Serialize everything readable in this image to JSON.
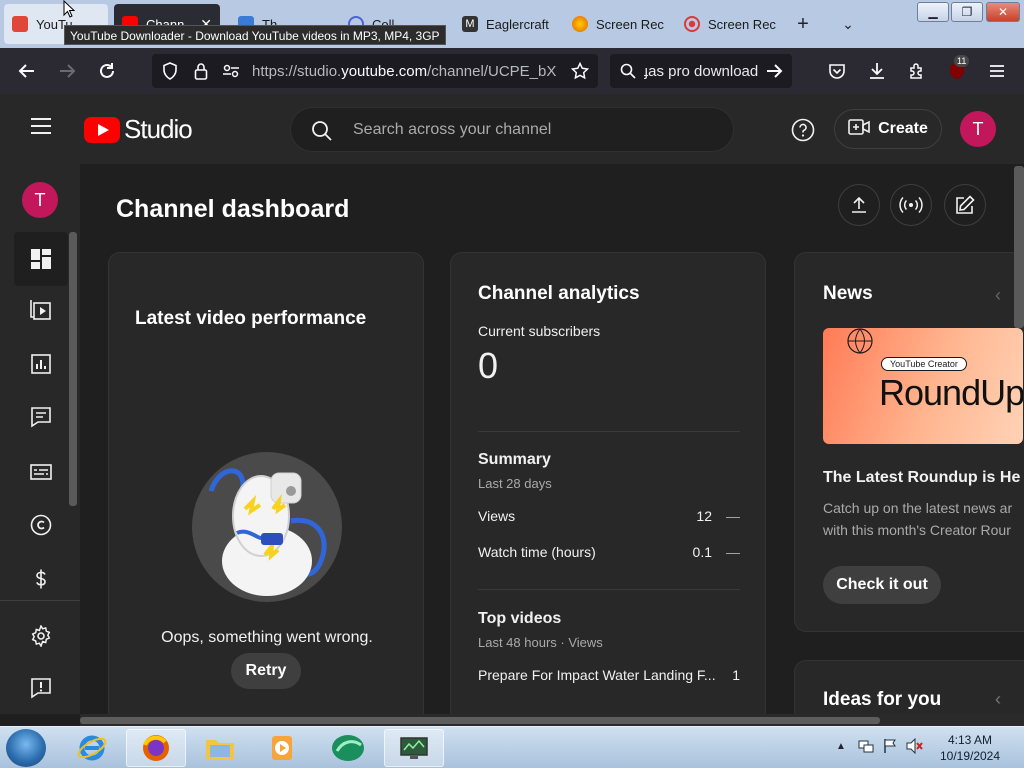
{
  "browser": {
    "tabs": [
      {
        "label": "YouTu",
        "icon": "download-icon",
        "color": "#e0463a"
      },
      {
        "label": "Chann",
        "icon": "youtube-icon",
        "color": "#ff0000"
      },
      {
        "label": "Th",
        "icon": "page-icon",
        "color": "#3b7bd5"
      },
      {
        "label": "Coll",
        "icon": "search-icon",
        "color": "#4a63d8"
      },
      {
        "label": "Eaglercraft",
        "icon": "m-icon",
        "color": "#333333"
      },
      {
        "label": "Screen Rec",
        "icon": "firefox-icon",
        "color": "#e66000"
      },
      {
        "label": "Screen Rec",
        "icon": "record-icon",
        "color": "#d93a3a"
      }
    ],
    "tooltip": "YouTube Downloader - Download YouTube videos in MP3, MP4, 3GP",
    "url_prefix": "https://studio.",
    "url_domain": "youtube.com",
    "url_rest": "/channel/UCPE_bX",
    "search_text": "ɟas pro download",
    "extension_badge": "11"
  },
  "studio": {
    "logo_text": "Studio",
    "search_placeholder": "Search across your channel",
    "create_label": "Create",
    "avatar_letter": "T"
  },
  "main": {
    "page_title": "Channel dashboard",
    "latest_video": {
      "title": "Latest video performance",
      "error": "Oops, something went wrong.",
      "retry": "Retry"
    },
    "analytics": {
      "title": "Channel analytics",
      "subs_label": "Current subscribers",
      "subs_value": "0",
      "summary_title": "Summary",
      "summary_period": "Last 28 days",
      "views_label": "Views",
      "views_value": "12",
      "views_trend": "—",
      "watch_label": "Watch time (hours)",
      "watch_value": "0.1",
      "watch_trend": "—",
      "top_title": "Top videos",
      "top_period": "Last 48 hours · Views",
      "top_video_title": "Prepare For Impact Water Landing F...",
      "top_video_views": "1"
    },
    "news": {
      "title": "News",
      "image_badge": "YouTube Creator",
      "image_title": "RoundUp",
      "headline": "The Latest Roundup is He",
      "body_line1": "Catch up on the latest news ar",
      "body_line2": "with this month's Creator Rour",
      "cta": "Check it out"
    },
    "ideas": {
      "title": "Ideas for you"
    }
  },
  "taskbar": {
    "time": "4:13 AM",
    "date": "10/19/2024"
  },
  "colors": {
    "yt_red": "#ff0000",
    "avatar": "#c2185b",
    "bg": "#1f1f1f",
    "card": "#282828"
  }
}
